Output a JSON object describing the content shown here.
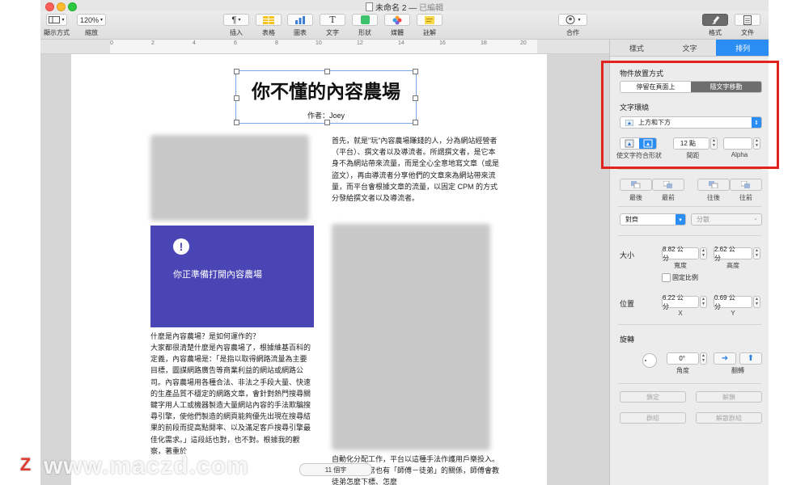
{
  "window": {
    "title": "未命名 2",
    "status": "已編輯"
  },
  "toolbar": {
    "view_label": "顯示方式",
    "zoom_value": "120%",
    "zoom_label": "縮放",
    "insert_label": "插入",
    "table_label": "表格",
    "chart_label": "圖表",
    "text_label": "文字",
    "shape_label": "形狀",
    "media_label": "媒體",
    "comment_label": "註解",
    "collaborate_label": "合作",
    "format_label": "格式",
    "document_label": "文件",
    "insert_icon": "pilcrow-icon",
    "text_icon": "T"
  },
  "ruler": {
    "marks": [
      "0",
      "2",
      "4",
      "6",
      "8",
      "10",
      "12",
      "14",
      "16",
      "18",
      "20"
    ]
  },
  "document": {
    "title": "你不懂的內容農場",
    "author": "作者：Joey",
    "banner_text": "你正準備打開內容農場",
    "banner_icon": "!",
    "col2_para": "首先，就是\"玩\"內容農場賺錢的人，分為網站經營者（平台）、撰文者以及導流者。所謂撰文者，是它本身不為網站帶來流量，而是全心全意地寫文章（或是盜文），再由導流者分享他們的文章來為網站帶來流量，而平台會根據文章的流量，以固定 CPM 的方式分發給撰文者以及導流者。",
    "col1_heading": "什麼是內容農場？是如何運作的？",
    "col1_para": "大家都很清楚什麼是內容農場了，根據維基百科的定義，內容農場是：「是指以取得網路流量為主要目標，圖謀網路廣告等商業利益的網站或網路公司。內容農場用各種合法、非法之手段大量、快速的生產品質不穩定的網路文章，會針對熱門搜尋關鍵字用人工或機器製造大量網站內容的手法欺騙搜尋引擎，使他們製造的網頁能夠優先出現在搜尋結果的前段而提高點閱率、以及滿足客戶搜尋引擎最佳化需求。」這段話也對，也不對。根據我的觀察，著重於",
    "col2_bottom": "自動化分配工作，平台以這種手法作護用戶樂投入。而上下線通常也有「師傅－徒弟」的關係，師傅會教徒弟怎麼下標、怎麼",
    "word_count": "11 個字"
  },
  "inspector": {
    "tabs": [
      "樣式",
      "文字",
      "排列"
    ],
    "active_tab": "排列",
    "placement_label": "物件放置方式",
    "stay_on_page": "停留在頁面上",
    "move_with_text": "隨文字移動",
    "wrap_label": "文字環繞",
    "wrap_value": "上方和下方",
    "fit_shape_label": "使文字符合形狀",
    "spacing_value": "12 點",
    "spacing_label": "間距",
    "alpha_label": "Alpha",
    "back_label": "最後",
    "front_label": "最前",
    "backward_label": "往後",
    "forward_label": "往前",
    "align_value": "對齊",
    "distribute_value": "分散",
    "size_label": "大小",
    "width_value": "8.82 公分",
    "width_label": "寬度",
    "height_value": "2.62 公分",
    "height_label": "高度",
    "constrain_label": "固定比例",
    "position_label": "位置",
    "x_value": "6.22 公分",
    "x_label": "X",
    "y_value": "0.69 公分",
    "y_label": "Y",
    "rotate_label": "旋轉",
    "angle_value": "0°",
    "angle_label": "角度",
    "flip_label": "翻轉",
    "lock_label": "鎖定",
    "unlock_label": "解鎖",
    "group_label": "群組",
    "ungroup_label": "解散群組"
  },
  "watermark": {
    "text": "www.maczd.com",
    "logo": "Z"
  }
}
